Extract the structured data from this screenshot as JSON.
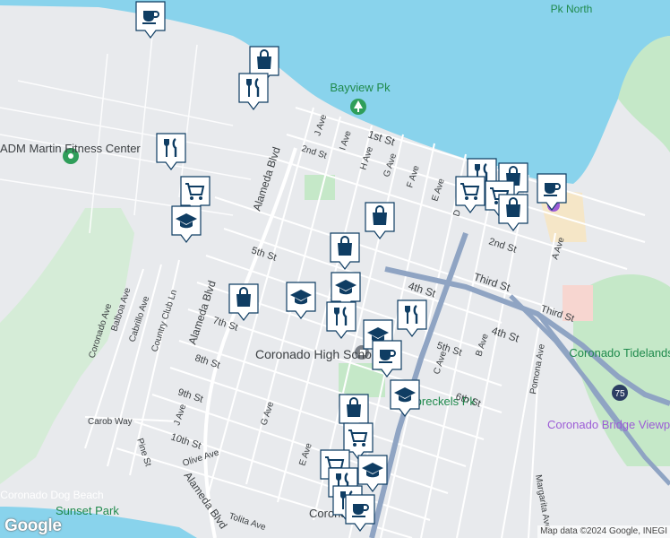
{
  "map": {
    "attribution": "Map data ©2024 Google, INEGI",
    "provider_logo": "Google",
    "colors": {
      "water": "#89d3ec",
      "land": "#e8eaed",
      "park": "#c5e8c8",
      "road": "#ffffff",
      "highway": "#8fa4c3",
      "pin": "#0f3d63",
      "pin_border": "#ffffff",
      "poi_green": "#2f9e5a",
      "poi_purple": "#9c5cd6"
    },
    "places": {
      "bayview_pk": "Bayview Pk",
      "tidelands_pk": "Coronado Tidelands Pk",
      "coronado_bridge_viewpoint": "Coronado Bridge Viewpoint",
      "coronado_high_school": "Coronado High School",
      "spreckels_pk": "Spreckels Pk",
      "sunset_park": "Sunset Park",
      "coronado_dog_beach": "Coronado Dog Beach",
      "martin_center": "ADM Martin Fitness Center",
      "pk_north": "Pk North",
      "coronado_town": "Coronado"
    },
    "streets": {
      "first_st": "1st St",
      "second_st": "2nd St",
      "second_st_e": "2nd St",
      "third_st": "Third St",
      "third_st_e": "Third St",
      "fourth_st": "4th St",
      "fourth_st_e": "4th St",
      "fifth_st": "5th St",
      "fifth_st_e": "5th St",
      "sixth_st": "6th St",
      "seventh_st": "7th St",
      "eighth_st": "8th St",
      "ninth_st": "9th St",
      "tenth_st": "10th St",
      "alameda_blvd_n": "Alameda Blvd",
      "alameda_blvd_m": "Alameda Blvd",
      "alameda_blvd_s": "Alameda Blvd",
      "j_ave": "J Ave",
      "i_ave": "I Ave",
      "h_ave": "H Ave",
      "g_ave": "G Ave",
      "f_ave": "F Ave",
      "e_ave": "E Ave",
      "d_ave": "D",
      "c_ave": "C Ave",
      "b_ave": "B Ave",
      "a_ave": "A Ave",
      "pomona_ave": "Pomona Ave",
      "margarita_ave": "Margarita Ave",
      "coronado_ave": "Coronado Ave",
      "balboa_ave": "Balboa Ave",
      "cabrillo_ave": "Cabrillo Ave",
      "country_club_ln": "Country Club Ln",
      "carob_way": "Carob Way",
      "pine_st": "Pine St",
      "olive_ave": "Olive Ave",
      "j_ave_s": "J Ave",
      "g_ave_s": "G Ave",
      "e_ave_s": "E Ave",
      "tolita_ave": "Tolita Ave",
      "hwy_75": "75"
    },
    "pin_icons": [
      {
        "name": "cafe-pin",
        "icon": "coffee-cup-icon"
      },
      {
        "name": "shopping-pin",
        "icon": "shopping-bag-icon"
      },
      {
        "name": "restaurant-pin",
        "icon": "fork-knife-icon"
      },
      {
        "name": "grocery-pin",
        "icon": "shopping-cart-icon"
      },
      {
        "name": "school-pin",
        "icon": "graduation-cap-icon"
      }
    ]
  }
}
